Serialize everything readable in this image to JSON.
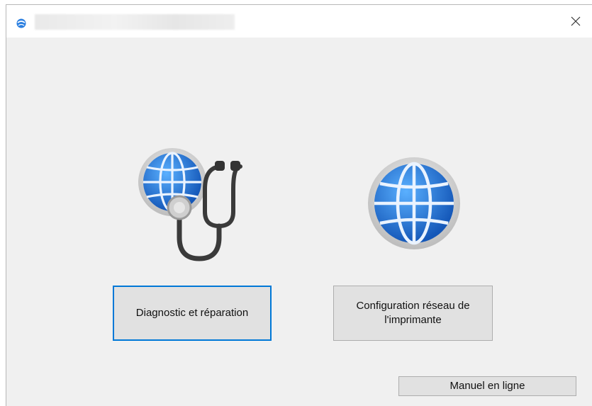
{
  "window": {
    "title": "",
    "close_label": "×"
  },
  "tools": [
    {
      "label": "Diagnostic et réparation",
      "icon": "globe-stethoscope-icon"
    },
    {
      "label": "Configuration réseau de l'imprimante",
      "icon": "globe-icon"
    }
  ],
  "footer": {
    "manual_label": "Manuel en ligne"
  },
  "colors": {
    "focus_border": "#0078d7",
    "button_bg": "#e1e1e1",
    "window_bg": "#f0f0f0",
    "globe_blue": "#1e6fd6"
  }
}
